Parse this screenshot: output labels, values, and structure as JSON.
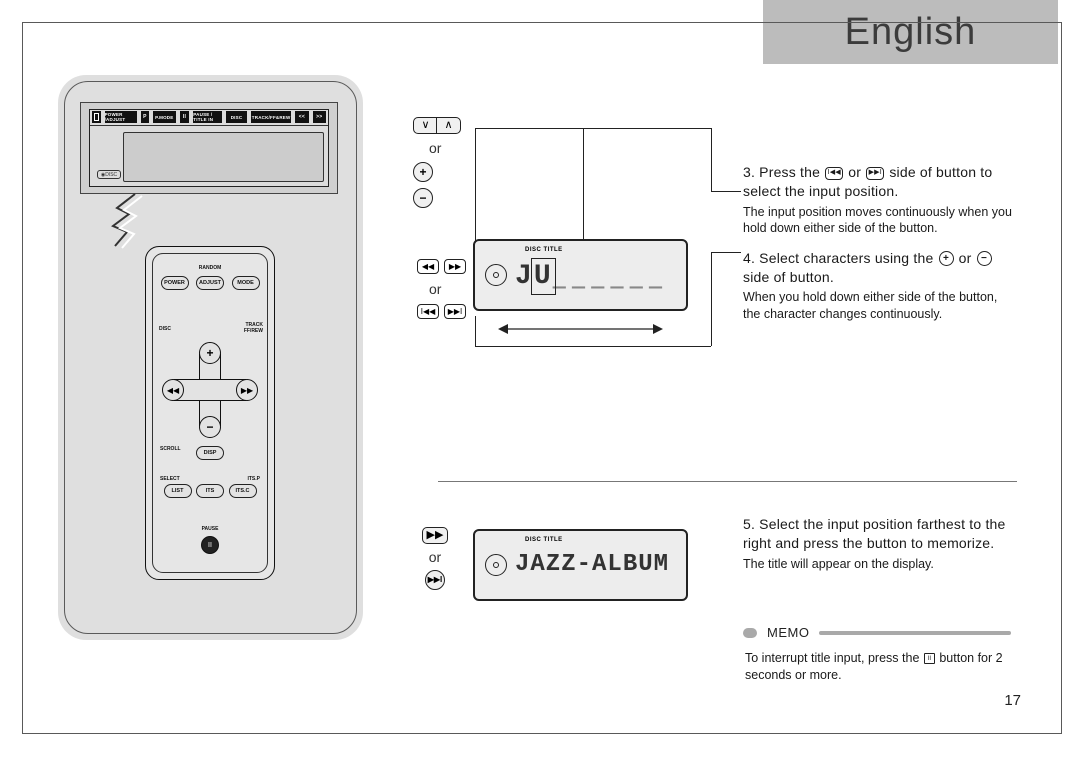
{
  "page": {
    "language_tab": "English",
    "number": "17"
  },
  "headunit_top": {
    "power_adjust": "POWER /ADJUST",
    "pmode": "P.MODE",
    "pause_title": "PAUSE / TITLE IN",
    "disc": "DISC",
    "track": "TRACK/FF&REW"
  },
  "remote": {
    "top_label_random": "RANDOM",
    "btn_power": "POWER",
    "btn_adjust": "ADJUST",
    "btn_mode": "MODE",
    "label_disc": "DISC",
    "label_track": "TRACK FF/REW",
    "label_scroll": "SCROLL",
    "label_select": "SELECT",
    "label_itsp": "ITS.P",
    "btn_disp": "DISP",
    "btn_list": "LIST",
    "btn_its": "ITS",
    "btn_itsc": "ITS.C",
    "label_pause": "PAUSE"
  },
  "icons": {
    "group1_or": "or",
    "group2_or": "or",
    "group3_or": "or",
    "split_left": "∨",
    "split_right": "∧",
    "plus": "+",
    "minus": "−",
    "rew": "I◀◀",
    "ff": "▶▶I",
    "rew_plain": "◀◀",
    "ff_plain": "▶▶"
  },
  "lcd": {
    "tag": "DISC TITLE",
    "text1_prefix": "J",
    "text1_cursor": "U",
    "text1_dashes": "______",
    "text2": "JAZZ-ALBUM"
  },
  "steps": {
    "s3_main_a": "3. Press the ",
    "s3_main_b": " or ",
    "s3_main_c": " side of button to select the input position.",
    "s3_sub": "The input position moves continuously when you hold down either side of the button.",
    "s4_main_a": "4. Select characters using the ",
    "s4_main_b": " or ",
    "s4_main_c": " side of button.",
    "s4_sub": "When you hold down either side of the button, the character changes continuously.",
    "s5_main": "5. Select the input position farthest to the right and press the button to memorize.",
    "s5_sub": "The title will appear on the display."
  },
  "memo": {
    "heading": "MEMO",
    "body_a": "To interrupt title input, press the ",
    "body_b": " button for 2 seconds or more.",
    "icon": "II"
  }
}
